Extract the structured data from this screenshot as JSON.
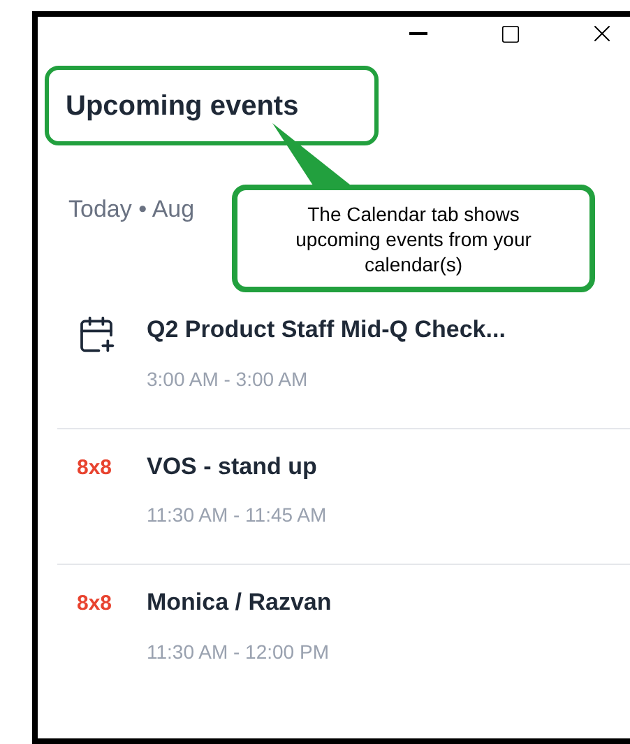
{
  "title": "Upcoming events",
  "date_header": "Today • Aug",
  "callout": "The Calendar tab shows upcoming events from your calendar(s)",
  "events": [
    {
      "kind": "calendar",
      "title": "Q2 Product Staff Mid-Q Check...",
      "time": "3:00 AM - 3:00 AM"
    },
    {
      "kind": "logo",
      "logo": "8x8",
      "title": "VOS - stand up",
      "time": "11:30 AM - 11:45 AM"
    },
    {
      "kind": "logo",
      "logo": "8x8",
      "title": "Monica / Razvan",
      "time": "11:30 AM - 12:00 PM"
    }
  ]
}
